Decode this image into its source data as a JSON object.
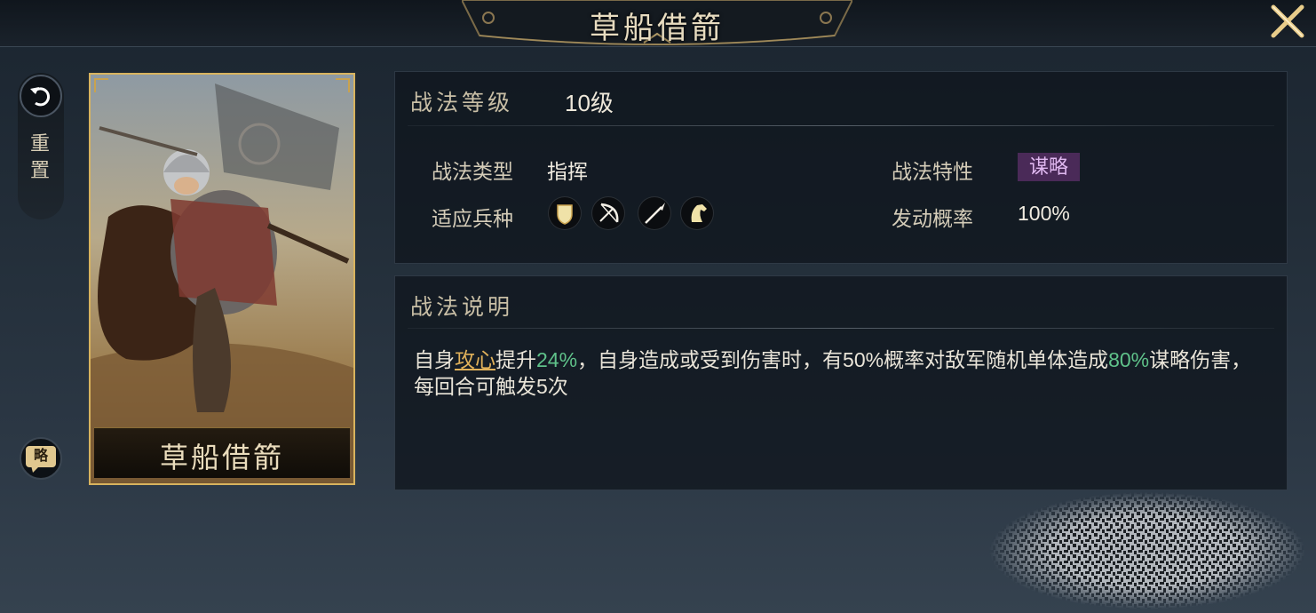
{
  "header": {
    "title": "草船借箭"
  },
  "sidebar": {
    "reset_label": "重置",
    "reset_icon": "undo-arrow-icon",
    "brief_label": "略"
  },
  "card": {
    "name": "草船借箭"
  },
  "info": {
    "level_label": "战法等级",
    "level_value": "10级",
    "type_label": "战法类型",
    "type_value": "指挥",
    "trait_label": "战法特性",
    "trait_value": "谋略",
    "troops_label": "适应兵种",
    "troops": [
      "shield-icon",
      "bow-icon",
      "spear-icon",
      "horse-icon"
    ],
    "trigger_label": "发动概率",
    "trigger_value": "100%"
  },
  "description": {
    "title": "战法说明",
    "p1": "自身",
    "keyword": "攻心",
    "p2": "提升",
    "val1": "24%",
    "p3": "，自身造成或受到伤害时，有50%概率对敌军随机单体造成",
    "val2": "80%",
    "p4": "谋略伤害，每回合可触发5次"
  },
  "colors": {
    "accent_gold": "#d8b35e",
    "highlight_green": "#5fc28a",
    "trait_purple": "#4a2a58"
  }
}
